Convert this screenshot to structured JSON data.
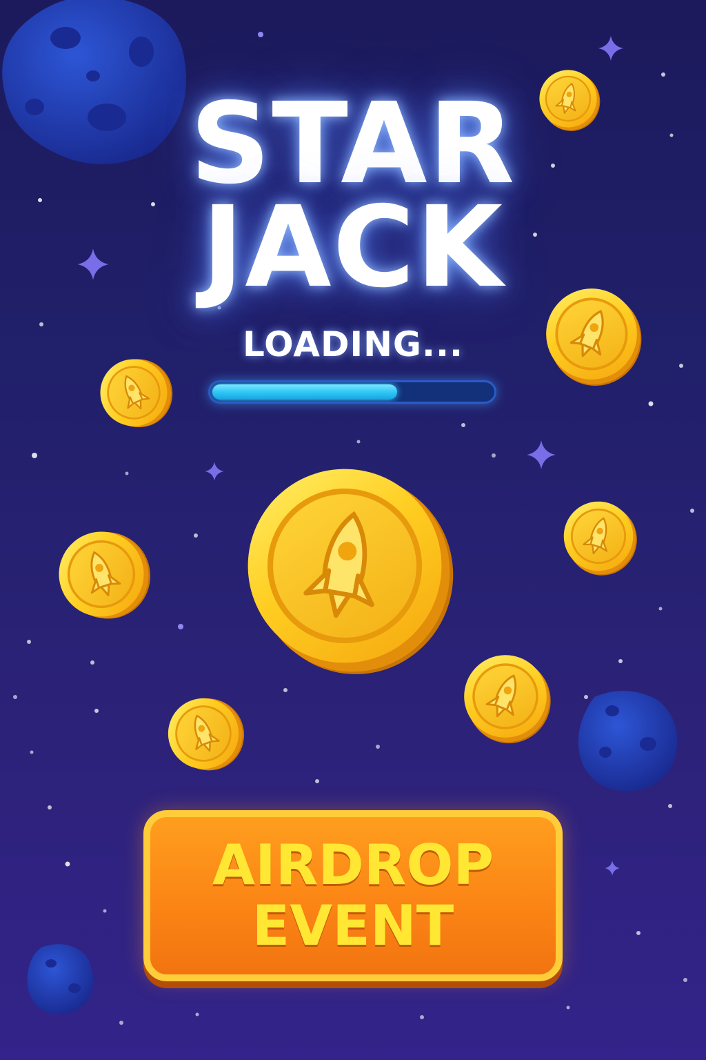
{
  "game": {
    "title_line_1": "STAR",
    "title_line_2": "JACK",
    "loading_label": "LOADING...",
    "loading_progress": 0.66
  },
  "event_button": {
    "line_1": "AIRDROP",
    "line_2": "EVENT"
  },
  "icons": {
    "coin": "rocket-coin-icon",
    "asteroid": "asteroid-icon",
    "sparkle": "sparkle-star-icon"
  },
  "colors": {
    "background_top": "#1c1a5c",
    "background_bottom": "#33238a",
    "coin_gold": "#ffc21a",
    "progress_fill": "#2cc4f5",
    "button_orange": "#fb8515",
    "button_text": "#ffe733",
    "asteroid_blue": "#223aa8"
  }
}
